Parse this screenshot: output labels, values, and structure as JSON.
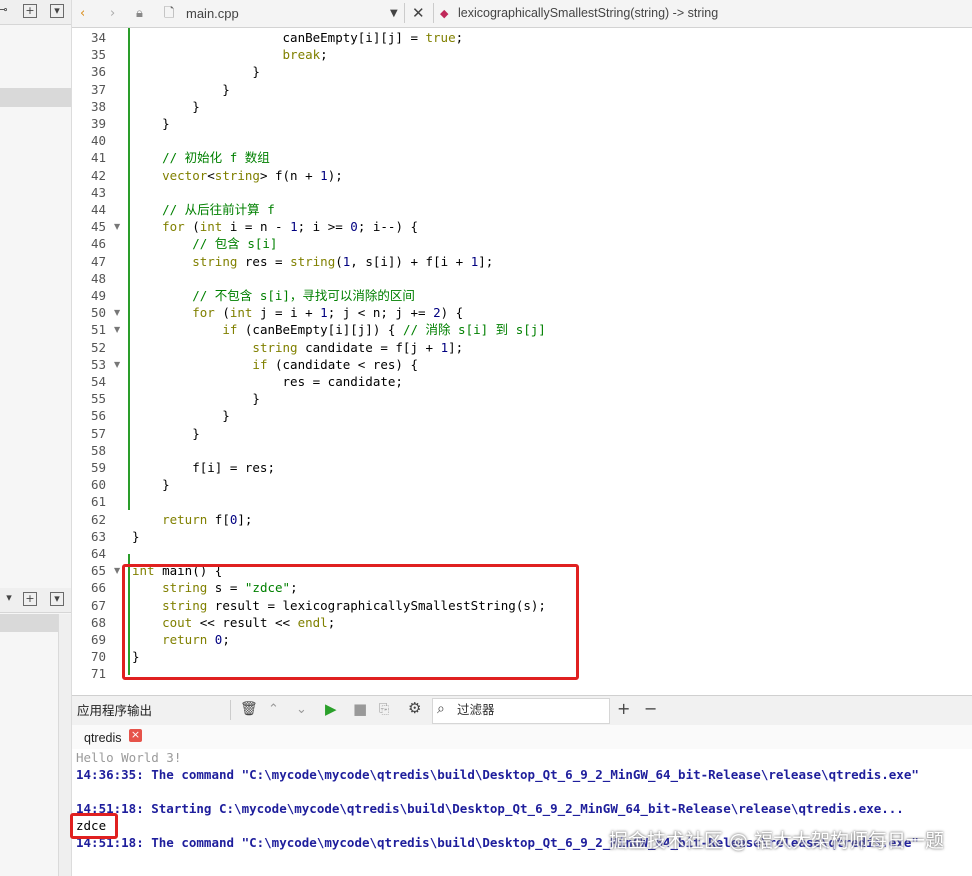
{
  "editor": {
    "file_name": "main.cpp",
    "function_nav": "lexicographicallySmallestString(string) -> string"
  },
  "code_lines": [
    {
      "n": "34",
      "t": "                canBeEmpty[i][j] = true;"
    },
    {
      "n": "35",
      "t": "                break;"
    },
    {
      "n": "36",
      "t": "            }"
    },
    {
      "n": "37",
      "t": "        }"
    },
    {
      "n": "38",
      "t": "    }"
    },
    {
      "n": "39",
      "t": "}"
    },
    {
      "n": "40",
      "t": ""
    },
    {
      "n": "41",
      "t": "// 初始化 f 数组"
    },
    {
      "n": "42",
      "t": "vector<string> f(n + 1);"
    },
    {
      "n": "43",
      "t": ""
    },
    {
      "n": "44",
      "t": "// 从后往前计算 f"
    },
    {
      "n": "45",
      "t": "for (int i = n - 1; i >= 0; i--) {"
    },
    {
      "n": "46",
      "t": "    // 包含 s[i]"
    },
    {
      "n": "47",
      "t": "    string res = string(1, s[i]) + f[i + 1];"
    },
    {
      "n": "48",
      "t": ""
    },
    {
      "n": "49",
      "t": "    // 不包含 s[i]，寻找可以消除的区间"
    },
    {
      "n": "50",
      "t": "    for (int j = i + 1; j < n; j += 2) {"
    },
    {
      "n": "51",
      "t": "        if (canBeEmpty[i][j]) { // 消除 s[i] 到 s[j]"
    },
    {
      "n": "52",
      "t": "            string candidate = f[j + 1];"
    },
    {
      "n": "53",
      "t": "            if (candidate < res) {"
    },
    {
      "n": "54",
      "t": "                res = candidate;"
    },
    {
      "n": "55",
      "t": "            }"
    },
    {
      "n": "56",
      "t": "        }"
    },
    {
      "n": "57",
      "t": "    }"
    },
    {
      "n": "58",
      "t": ""
    },
    {
      "n": "59",
      "t": "    f[i] = res;"
    },
    {
      "n": "60",
      "t": "}"
    },
    {
      "n": "61",
      "t": ""
    },
    {
      "n": "62",
      "t": "return f[0];"
    },
    {
      "n": "63",
      "t": "}"
    },
    {
      "n": "64",
      "t": ""
    },
    {
      "n": "65",
      "t": "int main() {"
    },
    {
      "n": "66",
      "t": "string s = \"zdce\";"
    },
    {
      "n": "67",
      "t": "string result = lexicographicallySmallestString(s);"
    },
    {
      "n": "68",
      "t": "cout << result << endl;"
    },
    {
      "n": "69",
      "t": "return 0;"
    },
    {
      "n": "70",
      "t": "}"
    },
    {
      "n": "71",
      "t": ""
    }
  ],
  "output_panel": {
    "title": "应用程序输出",
    "filter_placeholder": "过滤器",
    "tab_name": "qtredis",
    "tab_close": "×",
    "lines": [
      "Hello World 3!",
      "14:36:35: The command \"C:\\mycode\\mycode\\qtredis\\build\\Desktop_Qt_6_9_2_MinGW_64_bit-Release\\release\\qtredis.exe\"",
      "",
      "14:51:18: Starting C:\\mycode\\mycode\\qtredis\\build\\Desktop_Qt_6_9_2_MinGW_64_bit-Release\\release\\qtredis.exe...",
      "zdce",
      "14:51:18: The command \"C:\\mycode\\mycode\\qtredis\\build\\Desktop_Qt_6_9_2_MinGW_64_bit-Release\\release\\qtredis.exe\""
    ]
  },
  "watermark": "掘金技术社区 @ 福大大架构师每日一题",
  "icons": [
    "link-icon",
    "split-icon",
    "close-pane-icon",
    "back-icon",
    "forward-icon",
    "lock-icon",
    "file-icon",
    "dropdown-icon",
    "close-icon",
    "function-icon",
    "trash-icon",
    "up-icon",
    "down-icon",
    "run-icon",
    "stop-icon",
    "clear-icon",
    "settings-icon",
    "search-icon",
    "plus-icon",
    "minus-icon",
    "fold-icon"
  ],
  "colors": {
    "highlight": "#e02020",
    "keyword": "#808000",
    "string": "#008000",
    "output_message": "#1e1e9c",
    "change_bar": "#2a9d2a"
  }
}
